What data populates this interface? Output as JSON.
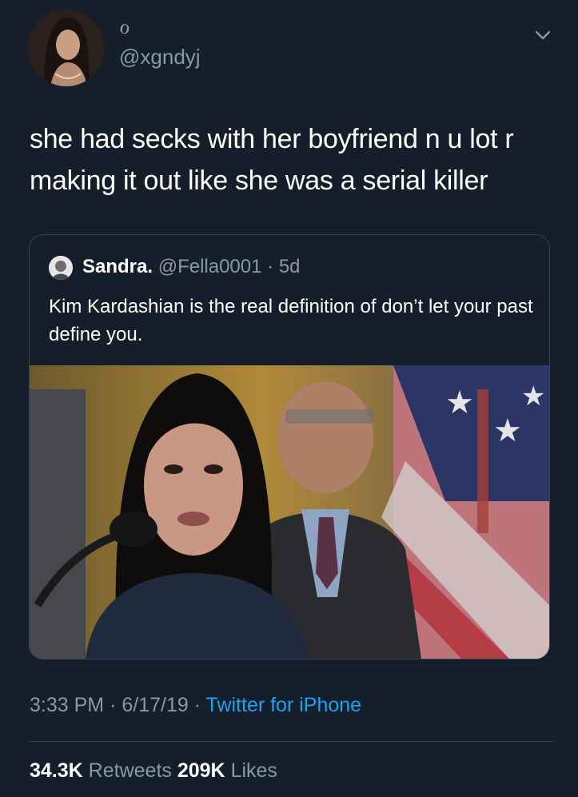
{
  "author": {
    "name_glyph": "ℴ",
    "handle": "@xgndyj"
  },
  "tweet": {
    "text": "she had secks with her boyfriend n u lot r making it out like she was a serial killer"
  },
  "quoted": {
    "name": "Sandra.",
    "handle": "@Fella0001",
    "separator": "·",
    "age": "5d",
    "text": "Kim Kardashian is the real definition of don’t let your past define you."
  },
  "meta": {
    "time": "3:33 PM",
    "sep1": "·",
    "date": "6/17/19",
    "sep2": "·",
    "source": "Twitter for iPhone"
  },
  "stats": {
    "retweets_count": "34.3K",
    "retweets_label": "Retweets",
    "likes_count": "209K",
    "likes_label": "Likes"
  },
  "colors": {
    "background": "#151f2b",
    "secondary_text": "#8899a6",
    "link": "#1da1f2",
    "border": "#38444d"
  },
  "icons": {
    "menu": "chevron-down-icon"
  }
}
